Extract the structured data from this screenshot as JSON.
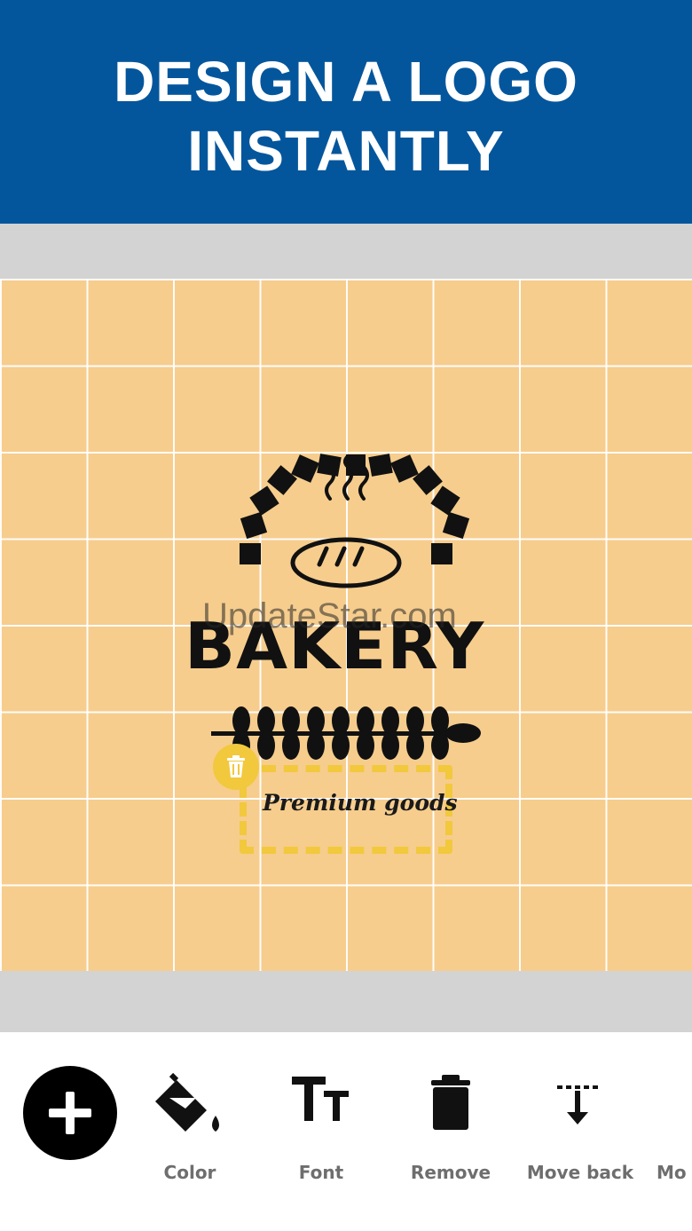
{
  "header": {
    "title_line1": "DESIGN A LOGO",
    "title_line2": "INSTANTLY"
  },
  "logo": {
    "name": "BAKERY",
    "tagline": "Premium goods"
  },
  "watermark": "UpdateStar.com",
  "toolbar": {
    "add_icon": "plus-icon",
    "items": [
      {
        "label": "Color",
        "icon": "paint-bucket-icon"
      },
      {
        "label": "Font",
        "icon": "text-size-icon"
      },
      {
        "label": "Remove",
        "icon": "trash-icon"
      },
      {
        "label": "Move back",
        "icon": "move-back-icon"
      },
      {
        "label": "Mo",
        "icon": "move-forward-icon"
      }
    ]
  },
  "colors": {
    "header_bg": "#04569c",
    "canvas_bg": "#f6cd8d",
    "selection": "#f2c83d",
    "gray_band": "#d3d3d3"
  }
}
